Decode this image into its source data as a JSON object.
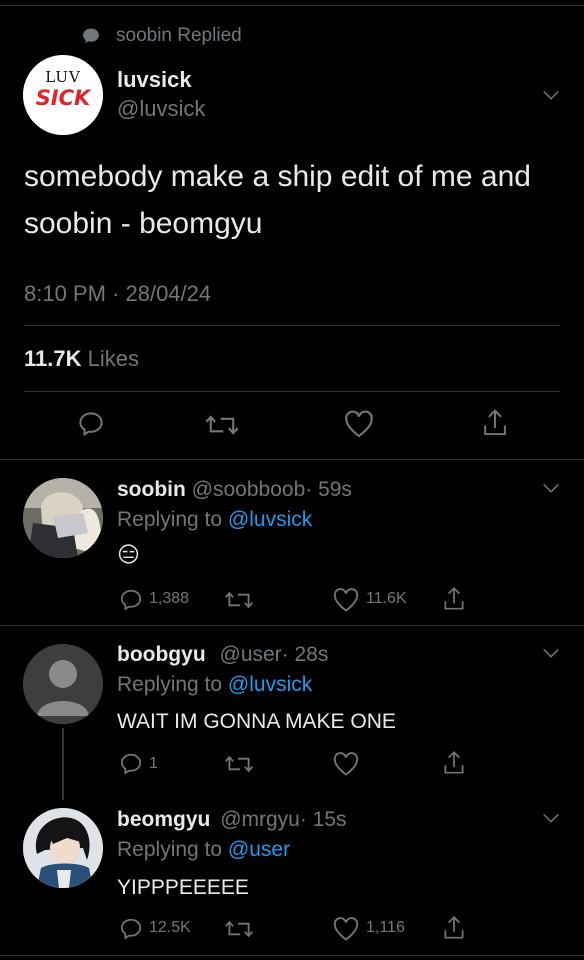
{
  "context": {
    "replied_text": "soobin Replied"
  },
  "main_tweet": {
    "display_name": "luvsick",
    "handle": "@luvsick",
    "avatar_text_top": "LUV",
    "avatar_text_bottom": "SICK",
    "text_line1": "somebody make a ship edit of me and",
    "text_line2": "soobin - beomgyu",
    "timestamp": "8:10 PM · 28/04/24",
    "likes_count": "11.7K",
    "likes_label": "Likes"
  },
  "replies": [
    {
      "display_name": "soobin",
      "handle": "@soobboob",
      "time": "· 59s",
      "replying_label": "Replying to",
      "replying_to": "@luvsick",
      "text": "😑",
      "reply_count": "1,388",
      "retweet_count": "",
      "like_count": "11.6K"
    },
    {
      "display_name": "boobgyu",
      "handle": "@user",
      "time": "· 28s",
      "replying_label": "Replying to",
      "replying_to": "@luvsick",
      "text": "WAIT IM GONNA MAKE ONE",
      "reply_count": "1",
      "retweet_count": "",
      "like_count": ""
    },
    {
      "display_name": "beomgyu",
      "handle": "@mrgyu",
      "time": "· 15s",
      "replying_label": "Replying to",
      "replying_to": "@user",
      "text": "YIPPPEEEEE",
      "reply_count": "12.5K",
      "retweet_count": "",
      "like_count": "1,116"
    }
  ],
  "colors": {
    "background": "#000000",
    "text": "#e7e9ea",
    "secondary": "#71767b",
    "link": "#1d9bf0",
    "divider": "#2f3336",
    "brand_red": "#e0242b"
  }
}
